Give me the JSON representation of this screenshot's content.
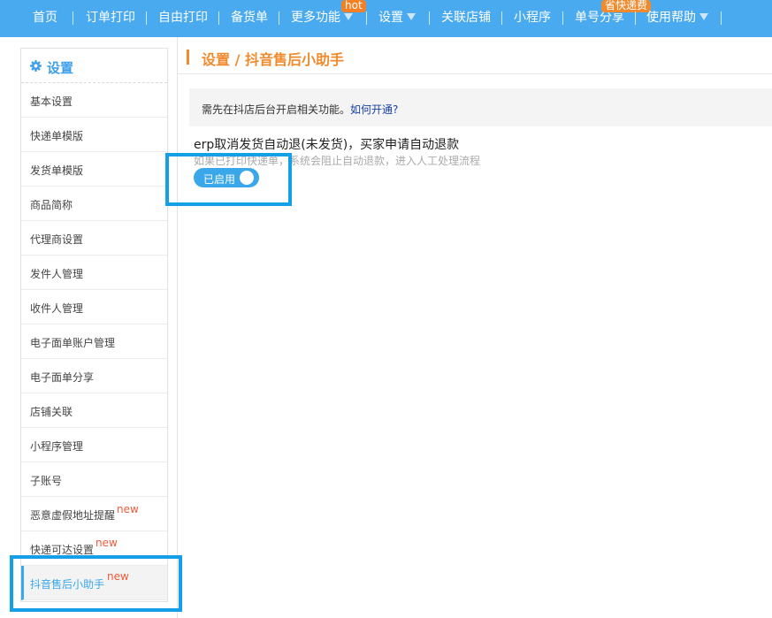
{
  "nav": {
    "items": [
      {
        "label": "首页"
      },
      {
        "label": "订单打印"
      },
      {
        "label": "自由打印"
      },
      {
        "label": "备货单"
      },
      {
        "label": "更多功能"
      },
      {
        "label": "设置"
      },
      {
        "label": "关联店铺"
      },
      {
        "label": "小程序"
      },
      {
        "label": "单号分享"
      },
      {
        "label": "使用帮助"
      }
    ],
    "badge_hot": "hot",
    "badge_save": "省快递费"
  },
  "sidebar": {
    "title": "设置",
    "items": [
      {
        "label": "基本设置"
      },
      {
        "label": "快递单模版"
      },
      {
        "label": "发货单模版"
      },
      {
        "label": "商品简称"
      },
      {
        "label": "代理商设置"
      },
      {
        "label": "发件人管理"
      },
      {
        "label": "收件人管理"
      },
      {
        "label": "电子面单账户管理"
      },
      {
        "label": "电子面单分享"
      },
      {
        "label": "店铺关联"
      },
      {
        "label": "小程序管理"
      },
      {
        "label": "子账号"
      },
      {
        "label": "恶意虚假地址提醒",
        "badge": "new"
      },
      {
        "label": "快递可达设置",
        "badge": "new"
      },
      {
        "label": "抖音售后小助手",
        "badge": "new",
        "active": true
      }
    ]
  },
  "content": {
    "breadcrumb": "设置 / 抖音售后小助手",
    "notice": {
      "text": "需先在抖店后台开启相关功能。",
      "link": "如何开通?"
    },
    "feature": {
      "title": "erp取消发货自动退(未发货)，买家申请自动退款",
      "desc": "如果已打印快递单，系统会阻止自动退款，进入人工处理流程",
      "toggle_label": "已启用",
      "enabled": true
    }
  },
  "colors": {
    "nav_bg": "#4aaaf0",
    "accent": "#3aa7ea",
    "orange": "#f08a2c",
    "highlight": "#14a0e8"
  }
}
